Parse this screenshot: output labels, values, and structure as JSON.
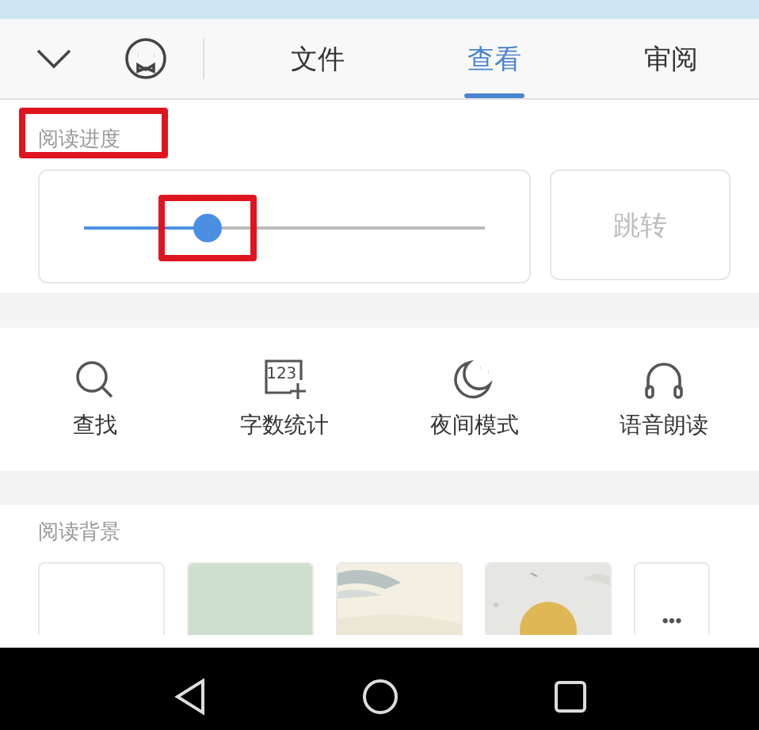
{
  "toolbar": {
    "tabs": [
      {
        "label": "文件",
        "selected": false
      },
      {
        "label": "查看",
        "selected": true
      },
      {
        "label": "审阅",
        "selected": false
      }
    ]
  },
  "reading_progress": {
    "title": "阅读进度",
    "level": 0.31,
    "jump_button": "跳转",
    "highlighted": true,
    "thumb_highlighted": true
  },
  "tools": [
    {
      "label": "查找",
      "kind": "search"
    },
    {
      "label": "字数统计",
      "kind": "count",
      "icon_text": "123"
    },
    {
      "label": "夜间模式",
      "kind": "night"
    },
    {
      "label": "语音朗读",
      "kind": "voice"
    }
  ],
  "reading_background": {
    "title": "阅读背景",
    "options": [
      {
        "kind": "plain",
        "color": "#ffffff"
      },
      {
        "kind": "plain",
        "color": "#cfdfcd"
      },
      {
        "kind": "picture"
      },
      {
        "kind": "picture"
      },
      {
        "kind": "more",
        "label": "•••"
      }
    ]
  }
}
